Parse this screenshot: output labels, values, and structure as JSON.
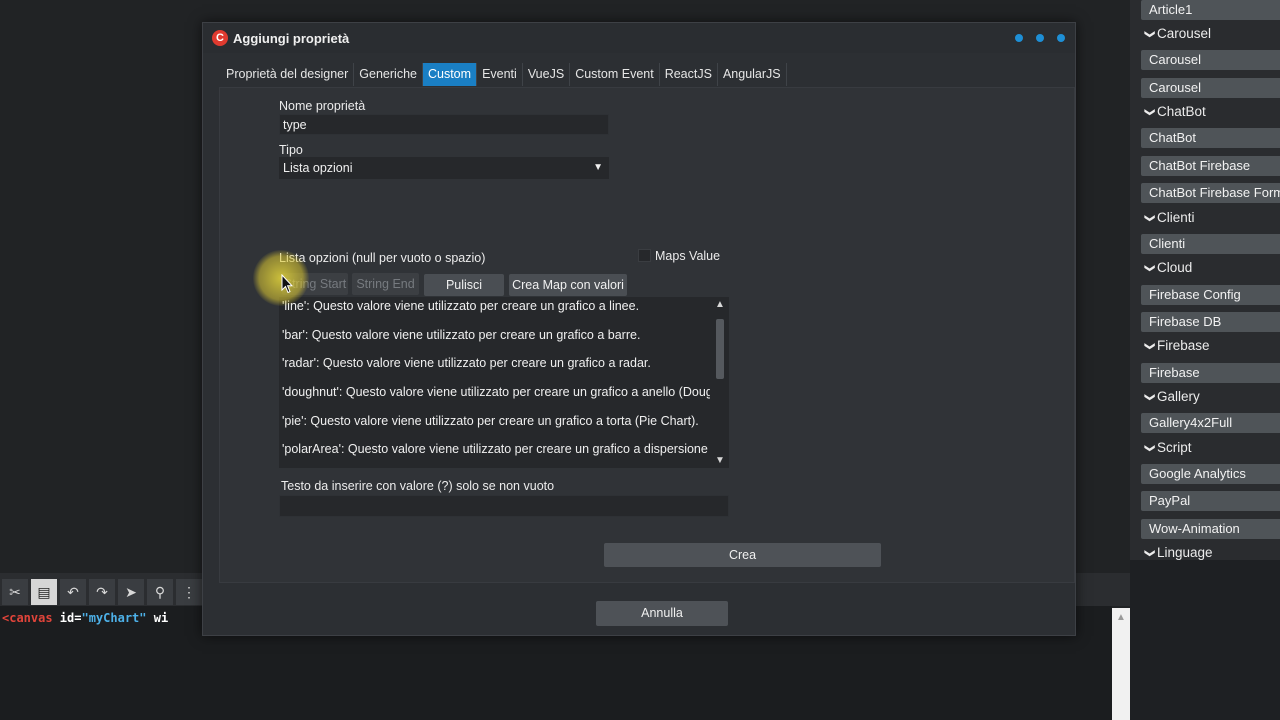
{
  "dialog": {
    "title": "Aggiungi proprietà",
    "logo_letter": "C"
  },
  "tabs": [
    {
      "label": "Proprietà del designer",
      "active": false
    },
    {
      "label": "Generiche",
      "active": false
    },
    {
      "label": "Custom",
      "active": true
    },
    {
      "label": "Eventi",
      "active": false
    },
    {
      "label": "VueJS",
      "active": false
    },
    {
      "label": "Custom Event",
      "active": false
    },
    {
      "label": "ReactJS",
      "active": false
    },
    {
      "label": "AngularJS",
      "active": false
    }
  ],
  "form": {
    "name_label": "Nome proprietà",
    "name_value": "type",
    "type_label": "Tipo",
    "type_value": "Lista opzioni",
    "options_label": "Lista opzioni (null per vuoto o spazio)",
    "maps_value_label": "Maps Value",
    "maps_value_checked": false,
    "string_start_label": "String Start",
    "string_end_label": "String End",
    "clear_label": "Pulisci",
    "create_map_label": "Crea Map con valori",
    "options_lines": [
      "'line': Questo valore viene utilizzato per creare un grafico a linee.",
      "'bar': Questo valore viene utilizzato per creare un grafico a barre.",
      "'radar': Questo valore viene utilizzato per creare un grafico a radar.",
      "'doughnut': Questo valore viene utilizzato per creare un grafico a anello (Doughnut Chart).",
      "'pie': Questo valore viene utilizzato per creare un grafico a torta (Pie Chart).",
      "'polarArea': Questo valore viene utilizzato per creare un grafico a dispersione polare."
    ],
    "text_insert_label": "Testo da inserire con valore (?) solo se non vuoto",
    "text_insert_value": "",
    "create_label": "Crea",
    "cancel_label": "Annulla"
  },
  "sidebar": {
    "entries": [
      {
        "kind": "item",
        "label": "Article1"
      },
      {
        "kind": "group",
        "label": "Carousel"
      },
      {
        "kind": "item",
        "label": "Carousel"
      },
      {
        "kind": "item",
        "label": "Carousel"
      },
      {
        "kind": "group",
        "label": "ChatBot"
      },
      {
        "kind": "item",
        "label": "ChatBot"
      },
      {
        "kind": "item",
        "label": "ChatBot Firebase"
      },
      {
        "kind": "item",
        "label": "ChatBot Firebase Form"
      },
      {
        "kind": "group",
        "label": "Clienti"
      },
      {
        "kind": "item",
        "label": "Clienti"
      },
      {
        "kind": "group",
        "label": "Cloud"
      },
      {
        "kind": "item",
        "label": "Firebase Config"
      },
      {
        "kind": "item",
        "label": "Firebase DB"
      },
      {
        "kind": "group",
        "label": "Firebase"
      },
      {
        "kind": "item",
        "label": "Firebase"
      },
      {
        "kind": "group",
        "label": "Gallery"
      },
      {
        "kind": "item",
        "label": "Gallery4x2Full"
      },
      {
        "kind": "group",
        "label": "Script"
      },
      {
        "kind": "item",
        "label": "Google Analytics"
      },
      {
        "kind": "item",
        "label": "PayPal"
      },
      {
        "kind": "item",
        "label": "Wow-Animation"
      },
      {
        "kind": "group",
        "label": "Linguage"
      }
    ]
  },
  "editor": {
    "code_tag": "<canvas",
    "code_attr": " id=",
    "code_str": "\"myChart\"",
    "code_rest": " wi"
  },
  "colors": {
    "accent": "#1a7fc4",
    "logo": "#e03a2f",
    "dialog_bg": "#2c2f33"
  }
}
